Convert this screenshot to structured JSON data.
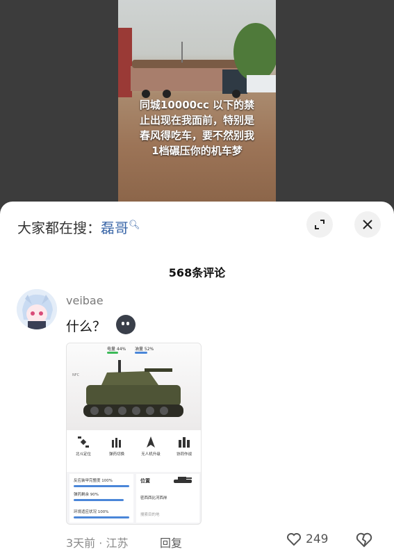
{
  "video": {
    "caption_lines": [
      "同城10000cc 以下的禁",
      "止出现在我面前，特别是",
      "春风得吃车，要不然别我",
      "1档碾压你的机车梦"
    ]
  },
  "search_bar": {
    "prefix": "大家都在搜：",
    "keyword": "磊哥",
    "icon": "search-icon"
  },
  "controls": {
    "expand_icon": "expand-icon",
    "close_icon": "close-icon"
  },
  "comments_header": {
    "count_label": "568条评论"
  },
  "comment": {
    "username": "veibae",
    "text": "什么？",
    "emoji": "black-ball-face-emoji",
    "image": {
      "top_stats": {
        "left": "电量 44%",
        "right": "油量 52%"
      },
      "nfc": "NFC",
      "icons": [
        {
          "label": "北斗定位",
          "icon": "satellite-icon"
        },
        {
          "label": "弹药切换",
          "icon": "ammo-icon"
        },
        {
          "label": "无人机升级",
          "icon": "drone-icon"
        },
        {
          "label": "协同作战",
          "icon": "team-icon"
        }
      ],
      "stats": [
        {
          "label": "反应装甲完整度",
          "value": "100%",
          "fill": 1.0
        },
        {
          "label": "弹药剩余",
          "value": "90%",
          "fill": 0.9
        },
        {
          "label": "环境适应状况",
          "value": "100%",
          "fill": 1.0
        }
      ],
      "location": {
        "title": "位置",
        "place": "密西西比河西岸",
        "search_placeholder": "搜索目的地"
      }
    },
    "meta": "3天前 · 江苏",
    "reply_label": "回复",
    "likes": "249"
  },
  "colors": {
    "accent": "#3b67a8",
    "sheet_bg": "#ffffff",
    "muted": "#8a8a8a"
  }
}
